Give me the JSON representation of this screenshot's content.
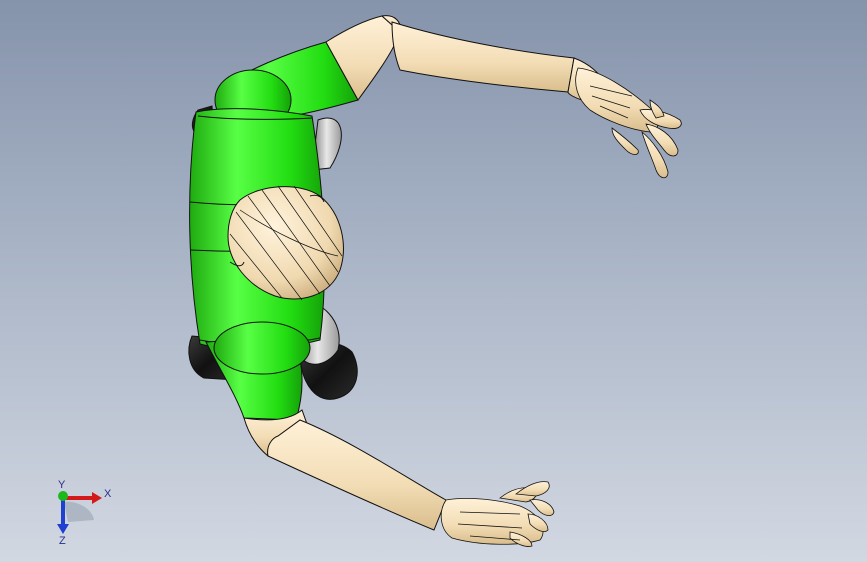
{
  "viewport": {
    "background_top": "#8593ab",
    "background_bottom": "#d2d8e2"
  },
  "model": {
    "shirt_color": "#22dd11",
    "skin_color": "#f2dcb4",
    "shoe_color": "#1a1a1a",
    "outline_color": "#111111"
  },
  "triad": {
    "x_label": "X",
    "y_label": "Y",
    "z_label": "Z",
    "x_color": "#d21a1a",
    "y_color": "#1cb81c",
    "z_color": "#1f3fd0",
    "icons": [
      "x-axis-arrow-icon",
      "y-axis-origin-icon",
      "z-axis-arrow-icon"
    ]
  }
}
